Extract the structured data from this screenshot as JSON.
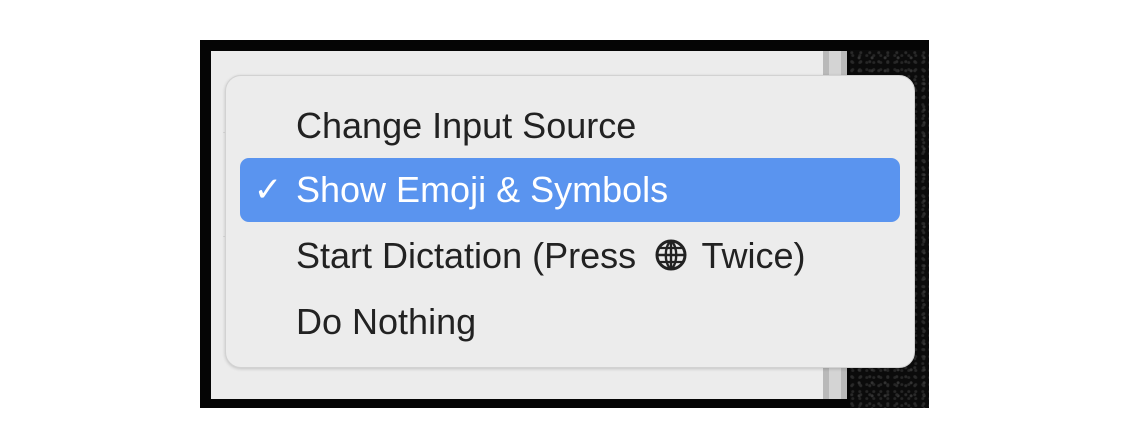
{
  "menu": {
    "items": [
      {
        "label": "Change Input Source",
        "checked": false,
        "selected": false
      },
      {
        "label": "Show Emoji & Symbols",
        "checked": true,
        "selected": true
      },
      {
        "label_before_icon": "Start Dictation (Press",
        "icon": "globe-icon",
        "label_after_icon": "Twice)",
        "checked": false,
        "selected": false
      },
      {
        "label": "Do Nothing",
        "checked": false,
        "selected": false
      }
    ],
    "checkmark": "✓",
    "highlight_color": "#5a94ef"
  }
}
